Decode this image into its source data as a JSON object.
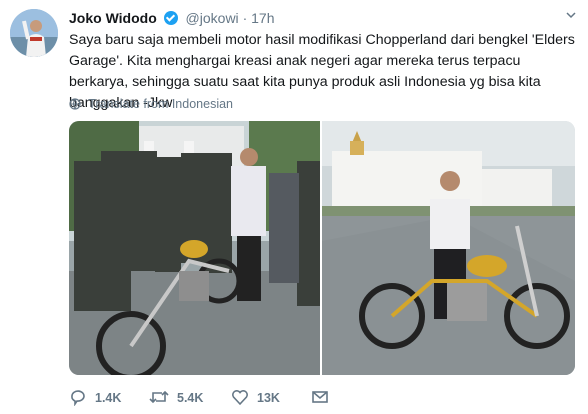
{
  "tweet": {
    "author_name": "Joko Widodo",
    "handle": "@jokowi",
    "separator": "·",
    "time": "17h",
    "text": "Saya baru saja membeli motor hasil modifikasi Chopperland dari bengkel 'Elders Garage'. Kita menghargai kreasi anak negeri agar mereka terus terpacu berkarya, sehingga suatu saat kita punya produk asli Indonesia yg bisa kita banggakan -Jkw",
    "translate_label": "Translate from Indonesian"
  },
  "actions": {
    "reply_count": "1.4K",
    "retweet_count": "5.4K",
    "like_count": "13K"
  },
  "icons": {
    "verified": "verified-badge-icon",
    "chevron": "chevron-down-icon",
    "globe": "globe-icon",
    "reply": "reply-icon",
    "retweet": "retweet-icon",
    "like": "heart-icon",
    "dm": "envelope-icon"
  },
  "colors": {
    "text": "#14171a",
    "secondary": "#657786",
    "verified": "#1da1f2"
  }
}
